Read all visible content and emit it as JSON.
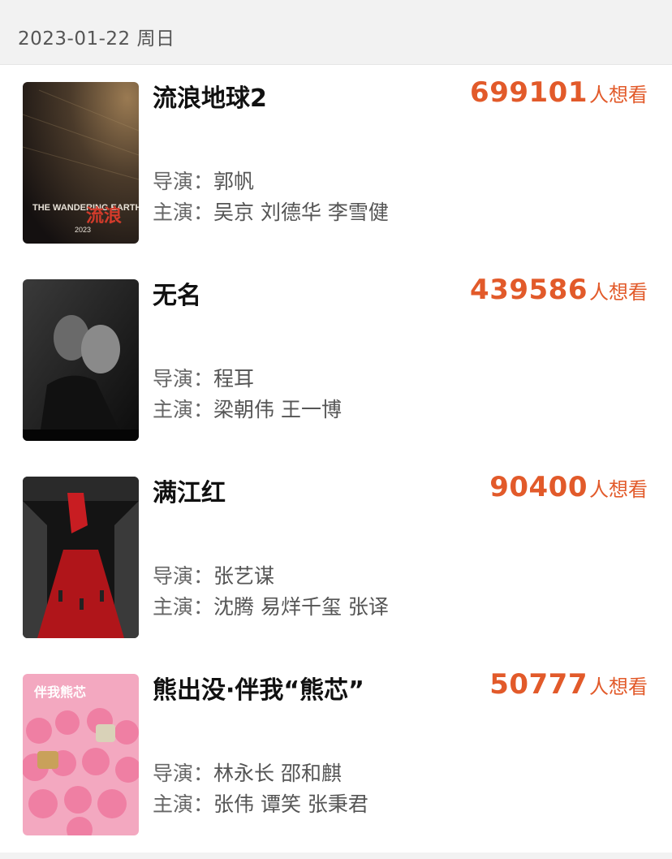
{
  "header": {
    "date": "2023-01-22 周日"
  },
  "labels": {
    "director": "导演：",
    "cast": "主演：",
    "wish_suffix": "人想看"
  },
  "movies": [
    {
      "title": "流浪地球2",
      "wish_count": "699101",
      "directors": "郭帆",
      "cast": "吴京 刘德华 李雪健",
      "poster_text": [
        "THE WANDERING EARTH Ⅱ",
        "2023"
      ]
    },
    {
      "title": "无名",
      "wish_count": "439586",
      "directors": "程耳",
      "cast": "梁朝伟 王一博",
      "poster_text": []
    },
    {
      "title": "满江红",
      "wish_count": "90400",
      "directors": "张艺谋",
      "cast": "沈腾 易烊千玺 张译",
      "poster_text": []
    },
    {
      "title": "熊出没·伴我“熊芯”",
      "wish_count": "50777",
      "directors": "林永长 邵和麒",
      "cast": "张伟 谭笑 张秉君",
      "poster_text": [
        "伴我熊芯"
      ]
    }
  ],
  "colors": {
    "accent": "#e25a2a",
    "header_bg": "#f2f2f2"
  }
}
